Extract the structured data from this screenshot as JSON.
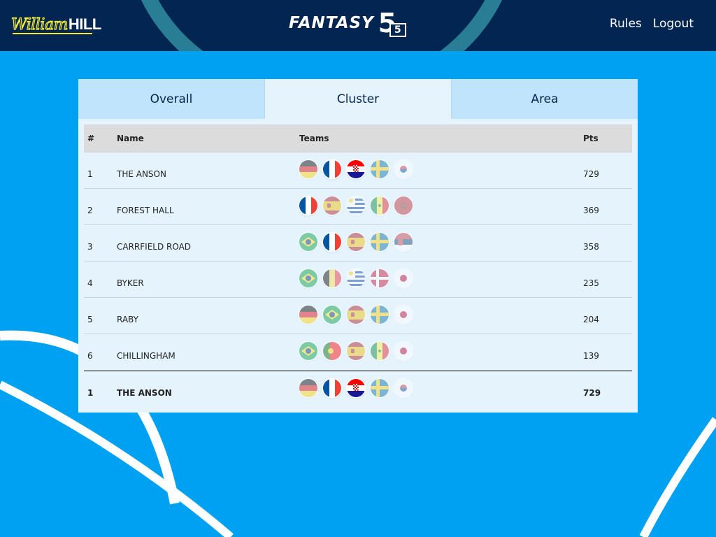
{
  "header": {
    "brand_script": "William",
    "brand_bold": "HILL",
    "product_text": "FANTASY",
    "product_number": "5",
    "product_number_small": "5",
    "links": {
      "rules": "Rules",
      "logout": "Logout"
    }
  },
  "tabs": [
    {
      "label": "Overall",
      "active": false
    },
    {
      "label": "Cluster",
      "active": true
    },
    {
      "label": "Area",
      "active": false
    }
  ],
  "table": {
    "headers": {
      "rank": "#",
      "name": "Name",
      "teams": "Teams",
      "pts": "Pts"
    },
    "rows": [
      {
        "rank": "1",
        "name": "THE ANSON",
        "pts": "729",
        "teams": [
          {
            "flag": "germany",
            "dim": true
          },
          {
            "flag": "france",
            "dim": false
          },
          {
            "flag": "croatia",
            "dim": false
          },
          {
            "flag": "sweden",
            "dim": true
          },
          {
            "flag": "south-korea",
            "dim": true
          }
        ]
      },
      {
        "rank": "2",
        "name": "FOREST HALL",
        "pts": "369",
        "teams": [
          {
            "flag": "france",
            "dim": false
          },
          {
            "flag": "spain",
            "dim": true
          },
          {
            "flag": "uruguay",
            "dim": true
          },
          {
            "flag": "senegal",
            "dim": true
          },
          {
            "flag": "morocco",
            "dim": true
          }
        ]
      },
      {
        "rank": "3",
        "name": "CARRFIELD ROAD",
        "pts": "358",
        "teams": [
          {
            "flag": "brazil",
            "dim": true
          },
          {
            "flag": "france",
            "dim": false
          },
          {
            "flag": "spain",
            "dim": true
          },
          {
            "flag": "sweden",
            "dim": true
          },
          {
            "flag": "serbia",
            "dim": true
          }
        ]
      },
      {
        "rank": "4",
        "name": "BYKER",
        "pts": "235",
        "teams": [
          {
            "flag": "brazil",
            "dim": true
          },
          {
            "flag": "belgium",
            "dim": true
          },
          {
            "flag": "uruguay",
            "dim": true
          },
          {
            "flag": "denmark",
            "dim": true
          },
          {
            "flag": "japan",
            "dim": true
          }
        ]
      },
      {
        "rank": "5",
        "name": "RABY",
        "pts": "204",
        "teams": [
          {
            "flag": "germany",
            "dim": true
          },
          {
            "flag": "brazil",
            "dim": true
          },
          {
            "flag": "spain",
            "dim": true
          },
          {
            "flag": "sweden",
            "dim": true
          },
          {
            "flag": "japan",
            "dim": true
          }
        ]
      },
      {
        "rank": "6",
        "name": "CHILLINGHAM",
        "pts": "139",
        "teams": [
          {
            "flag": "brazil",
            "dim": true
          },
          {
            "flag": "portugal",
            "dim": true
          },
          {
            "flag": "spain",
            "dim": true
          },
          {
            "flag": "senegal",
            "dim": true
          },
          {
            "flag": "japan",
            "dim": true
          }
        ]
      }
    ],
    "user_row": {
      "rank": "1",
      "name": "THE ANSON",
      "pts": "729",
      "teams": [
        {
          "flag": "germany",
          "dim": true
        },
        {
          "flag": "france",
          "dim": false
        },
        {
          "flag": "croatia",
          "dim": false
        },
        {
          "flag": "sweden",
          "dim": true
        },
        {
          "flag": "south-korea",
          "dim": true
        }
      ]
    }
  },
  "colors": {
    "background": "#00a1f1",
    "header": "#032552",
    "panel": "#e4f3fc",
    "tab_inactive": "#bfe4fb",
    "brand_yellow": "#f2ea3a"
  }
}
